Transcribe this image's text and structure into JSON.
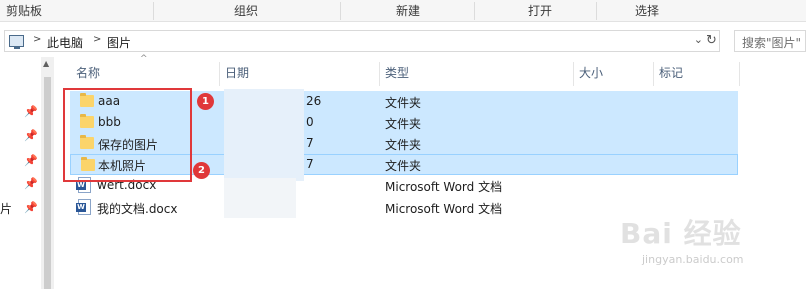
{
  "ribbon": {
    "groups": [
      "剪贴板",
      "组织",
      "新建",
      "打开",
      "选择"
    ]
  },
  "address": {
    "breadcrumbs": [
      "此电脑",
      "图片"
    ],
    "search_placeholder": "搜索\"图片\""
  },
  "nav": {
    "partial_label": "片"
  },
  "columns": {
    "name": "名称",
    "date": "日期",
    "type": "类型",
    "size": "大小",
    "tags": "标记"
  },
  "files": [
    {
      "name": "aaa",
      "date_partial": "26",
      "type": "文件夹",
      "kind": "folder",
      "selected": true
    },
    {
      "name": "bbb",
      "date_partial": "0",
      "type": "文件夹",
      "kind": "folder",
      "selected": true
    },
    {
      "name": "保存的图片",
      "date_partial": "7",
      "type": "文件夹",
      "kind": "folder",
      "selected": true
    },
    {
      "name": "本机照片",
      "date_partial": "7",
      "type": "文件夹",
      "kind": "folder",
      "selected": true
    },
    {
      "name": "wert.docx",
      "date_partial": "",
      "type": "Microsoft Word 文档",
      "kind": "word",
      "selected": false
    },
    {
      "name": "我的文档.docx",
      "date_partial": "",
      "type": "Microsoft Word 文档",
      "kind": "word",
      "selected": false
    }
  ],
  "annotations": {
    "badge_1": "1",
    "badge_2": "2"
  },
  "watermark": {
    "main": "Bai 经验",
    "sub": "jingyan.baidu.com"
  },
  "colors": {
    "selection": "#cce8ff",
    "annotation": "#e0383a"
  }
}
